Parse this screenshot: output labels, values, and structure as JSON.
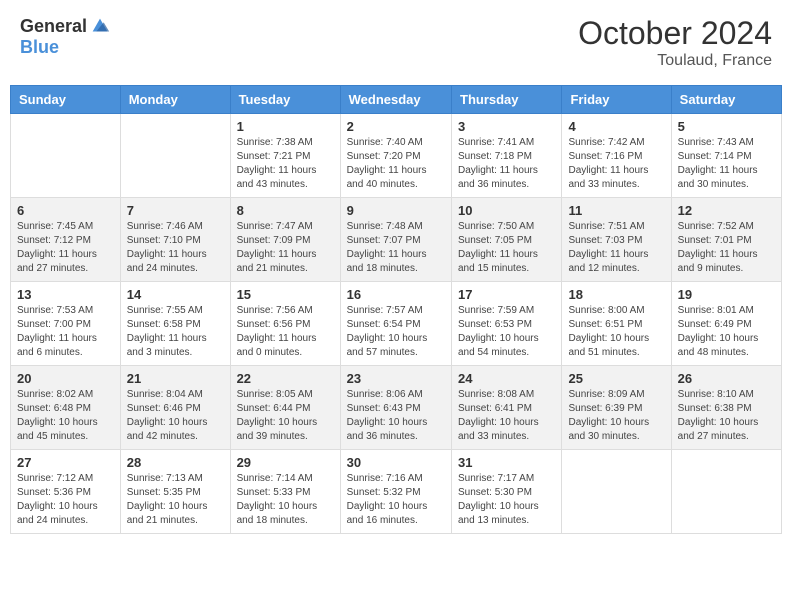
{
  "header": {
    "logo_general": "General",
    "logo_blue": "Blue",
    "month_title": "October 2024",
    "location": "Toulaud, France"
  },
  "days_of_week": [
    "Sunday",
    "Monday",
    "Tuesday",
    "Wednesday",
    "Thursday",
    "Friday",
    "Saturday"
  ],
  "weeks": [
    [
      {
        "day": "",
        "sunrise": "",
        "sunset": "",
        "daylight": ""
      },
      {
        "day": "",
        "sunrise": "",
        "sunset": "",
        "daylight": ""
      },
      {
        "day": "1",
        "sunrise": "Sunrise: 7:38 AM",
        "sunset": "Sunset: 7:21 PM",
        "daylight": "Daylight: 11 hours and 43 minutes."
      },
      {
        "day": "2",
        "sunrise": "Sunrise: 7:40 AM",
        "sunset": "Sunset: 7:20 PM",
        "daylight": "Daylight: 11 hours and 40 minutes."
      },
      {
        "day": "3",
        "sunrise": "Sunrise: 7:41 AM",
        "sunset": "Sunset: 7:18 PM",
        "daylight": "Daylight: 11 hours and 36 minutes."
      },
      {
        "day": "4",
        "sunrise": "Sunrise: 7:42 AM",
        "sunset": "Sunset: 7:16 PM",
        "daylight": "Daylight: 11 hours and 33 minutes."
      },
      {
        "day": "5",
        "sunrise": "Sunrise: 7:43 AM",
        "sunset": "Sunset: 7:14 PM",
        "daylight": "Daylight: 11 hours and 30 minutes."
      }
    ],
    [
      {
        "day": "6",
        "sunrise": "Sunrise: 7:45 AM",
        "sunset": "Sunset: 7:12 PM",
        "daylight": "Daylight: 11 hours and 27 minutes."
      },
      {
        "day": "7",
        "sunrise": "Sunrise: 7:46 AM",
        "sunset": "Sunset: 7:10 PM",
        "daylight": "Daylight: 11 hours and 24 minutes."
      },
      {
        "day": "8",
        "sunrise": "Sunrise: 7:47 AM",
        "sunset": "Sunset: 7:09 PM",
        "daylight": "Daylight: 11 hours and 21 minutes."
      },
      {
        "day": "9",
        "sunrise": "Sunrise: 7:48 AM",
        "sunset": "Sunset: 7:07 PM",
        "daylight": "Daylight: 11 hours and 18 minutes."
      },
      {
        "day": "10",
        "sunrise": "Sunrise: 7:50 AM",
        "sunset": "Sunset: 7:05 PM",
        "daylight": "Daylight: 11 hours and 15 minutes."
      },
      {
        "day": "11",
        "sunrise": "Sunrise: 7:51 AM",
        "sunset": "Sunset: 7:03 PM",
        "daylight": "Daylight: 11 hours and 12 minutes."
      },
      {
        "day": "12",
        "sunrise": "Sunrise: 7:52 AM",
        "sunset": "Sunset: 7:01 PM",
        "daylight": "Daylight: 11 hours and 9 minutes."
      }
    ],
    [
      {
        "day": "13",
        "sunrise": "Sunrise: 7:53 AM",
        "sunset": "Sunset: 7:00 PM",
        "daylight": "Daylight: 11 hours and 6 minutes."
      },
      {
        "day": "14",
        "sunrise": "Sunrise: 7:55 AM",
        "sunset": "Sunset: 6:58 PM",
        "daylight": "Daylight: 11 hours and 3 minutes."
      },
      {
        "day": "15",
        "sunrise": "Sunrise: 7:56 AM",
        "sunset": "Sunset: 6:56 PM",
        "daylight": "Daylight: 11 hours and 0 minutes."
      },
      {
        "day": "16",
        "sunrise": "Sunrise: 7:57 AM",
        "sunset": "Sunset: 6:54 PM",
        "daylight": "Daylight: 10 hours and 57 minutes."
      },
      {
        "day": "17",
        "sunrise": "Sunrise: 7:59 AM",
        "sunset": "Sunset: 6:53 PM",
        "daylight": "Daylight: 10 hours and 54 minutes."
      },
      {
        "day": "18",
        "sunrise": "Sunrise: 8:00 AM",
        "sunset": "Sunset: 6:51 PM",
        "daylight": "Daylight: 10 hours and 51 minutes."
      },
      {
        "day": "19",
        "sunrise": "Sunrise: 8:01 AM",
        "sunset": "Sunset: 6:49 PM",
        "daylight": "Daylight: 10 hours and 48 minutes."
      }
    ],
    [
      {
        "day": "20",
        "sunrise": "Sunrise: 8:02 AM",
        "sunset": "Sunset: 6:48 PM",
        "daylight": "Daylight: 10 hours and 45 minutes."
      },
      {
        "day": "21",
        "sunrise": "Sunrise: 8:04 AM",
        "sunset": "Sunset: 6:46 PM",
        "daylight": "Daylight: 10 hours and 42 minutes."
      },
      {
        "day": "22",
        "sunrise": "Sunrise: 8:05 AM",
        "sunset": "Sunset: 6:44 PM",
        "daylight": "Daylight: 10 hours and 39 minutes."
      },
      {
        "day": "23",
        "sunrise": "Sunrise: 8:06 AM",
        "sunset": "Sunset: 6:43 PM",
        "daylight": "Daylight: 10 hours and 36 minutes."
      },
      {
        "day": "24",
        "sunrise": "Sunrise: 8:08 AM",
        "sunset": "Sunset: 6:41 PM",
        "daylight": "Daylight: 10 hours and 33 minutes."
      },
      {
        "day": "25",
        "sunrise": "Sunrise: 8:09 AM",
        "sunset": "Sunset: 6:39 PM",
        "daylight": "Daylight: 10 hours and 30 minutes."
      },
      {
        "day": "26",
        "sunrise": "Sunrise: 8:10 AM",
        "sunset": "Sunset: 6:38 PM",
        "daylight": "Daylight: 10 hours and 27 minutes."
      }
    ],
    [
      {
        "day": "27",
        "sunrise": "Sunrise: 7:12 AM",
        "sunset": "Sunset: 5:36 PM",
        "daylight": "Daylight: 10 hours and 24 minutes."
      },
      {
        "day": "28",
        "sunrise": "Sunrise: 7:13 AM",
        "sunset": "Sunset: 5:35 PM",
        "daylight": "Daylight: 10 hours and 21 minutes."
      },
      {
        "day": "29",
        "sunrise": "Sunrise: 7:14 AM",
        "sunset": "Sunset: 5:33 PM",
        "daylight": "Daylight: 10 hours and 18 minutes."
      },
      {
        "day": "30",
        "sunrise": "Sunrise: 7:16 AM",
        "sunset": "Sunset: 5:32 PM",
        "daylight": "Daylight: 10 hours and 16 minutes."
      },
      {
        "day": "31",
        "sunrise": "Sunrise: 7:17 AM",
        "sunset": "Sunset: 5:30 PM",
        "daylight": "Daylight: 10 hours and 13 minutes."
      },
      {
        "day": "",
        "sunrise": "",
        "sunset": "",
        "daylight": ""
      },
      {
        "day": "",
        "sunrise": "",
        "sunset": "",
        "daylight": ""
      }
    ]
  ]
}
